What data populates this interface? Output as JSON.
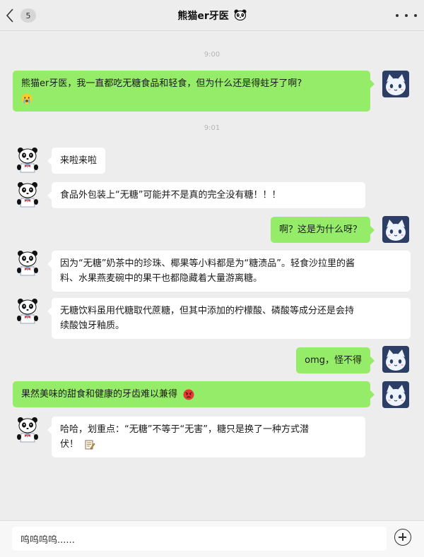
{
  "header": {
    "unread_count": "5",
    "title": "熊猫er牙医",
    "title_icon": "panda-face-icon"
  },
  "messages": [
    {
      "kind": "time",
      "text": "9:00"
    },
    {
      "kind": "msg",
      "side": "right",
      "avatar": "cat-avatar",
      "text": "熊猫er牙医，我一直都吃无糖食品和轻食，但为什么还是得蛀牙了啊?",
      "emoji": "crying-face-icon"
    },
    {
      "kind": "time",
      "text": "9:01"
    },
    {
      "kind": "msg",
      "side": "left",
      "avatar": "panda-doctor-avatar",
      "text": "来啦来啦"
    },
    {
      "kind": "msg",
      "side": "left",
      "avatar": "panda-doctor-avatar",
      "text": "食品外包装上“无糖”可能并不是真的完全没有糖！！！"
    },
    {
      "kind": "msg",
      "side": "right",
      "avatar": "cat-avatar",
      "text": "啊？这是为什么呀？"
    },
    {
      "kind": "msg",
      "side": "left",
      "avatar": "panda-doctor-avatar",
      "lines": [
        "因为“无糖”奶茶中的珍珠、椰果等小料都是为“糖渍品”。轻食沙拉里的酱",
        "料、水果燕麦碗中的果干也都隐藏着大量游离糖。"
      ]
    },
    {
      "kind": "msg",
      "side": "left",
      "avatar": "panda-doctor-avatar",
      "lines": [
        "无糖饮料虽用代糖取代蔗糖，但其中添加的柠檬酸、磷酸等成分还是会持",
        "续酸蚀牙釉质。"
      ]
    },
    {
      "kind": "msg",
      "side": "right",
      "avatar": "cat-avatar",
      "text": "omg，怪不得"
    },
    {
      "kind": "msg",
      "side": "right",
      "avatar": "cat-avatar",
      "text": "果然美味的甜食和健康的牙齿难以兼得",
      "emoji": "angry-face-icon"
    },
    {
      "kind": "msg",
      "side": "left",
      "avatar": "panda-doctor-avatar",
      "lines": [
        "哈哈，划重点：“无糖”不等于“无害”，糖只是换了一种方式潜",
        "伏！"
      ],
      "emoji": "memo-icon"
    }
  ],
  "input": {
    "value": "呜呜呜呜......"
  },
  "colors": {
    "outgoing_bubble": "#95ec69",
    "incoming_bubble": "#ffffff",
    "background": "#ededed"
  }
}
